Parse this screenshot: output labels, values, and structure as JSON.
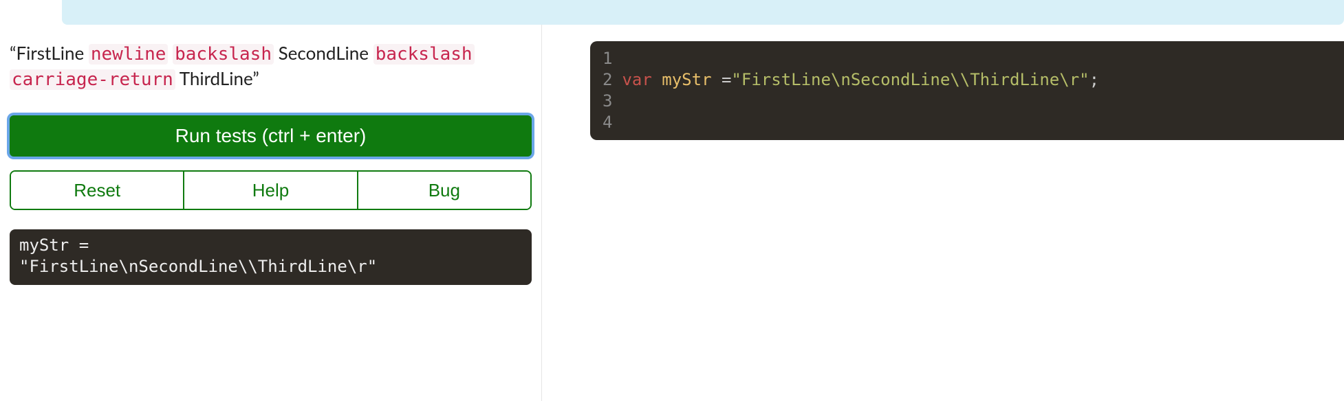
{
  "instruction": {
    "q_open": "“",
    "t1": "FirstLine",
    "c1": "newline",
    "c2": "backslash",
    "t2": "SecondLine",
    "c3": "backslash",
    "c4": "carriage-return",
    "t3": "ThirdLine",
    "q_close": "”"
  },
  "buttons": {
    "run": "Run tests (ctrl + enter)",
    "reset": "Reset",
    "help": "Help",
    "bug": "Bug"
  },
  "output": "myStr =\n\"FirstLine\\nSecondLine\\\\ThirdLine\\r\"",
  "editor": {
    "line_numbers": [
      "1",
      "2",
      "3",
      "4"
    ],
    "line2": {
      "kw": "var",
      "var": "myStr",
      "op": " =",
      "str": "\"FirstLine\\nSecondLine\\\\ThirdLine\\r\"",
      "semi": ";"
    }
  }
}
